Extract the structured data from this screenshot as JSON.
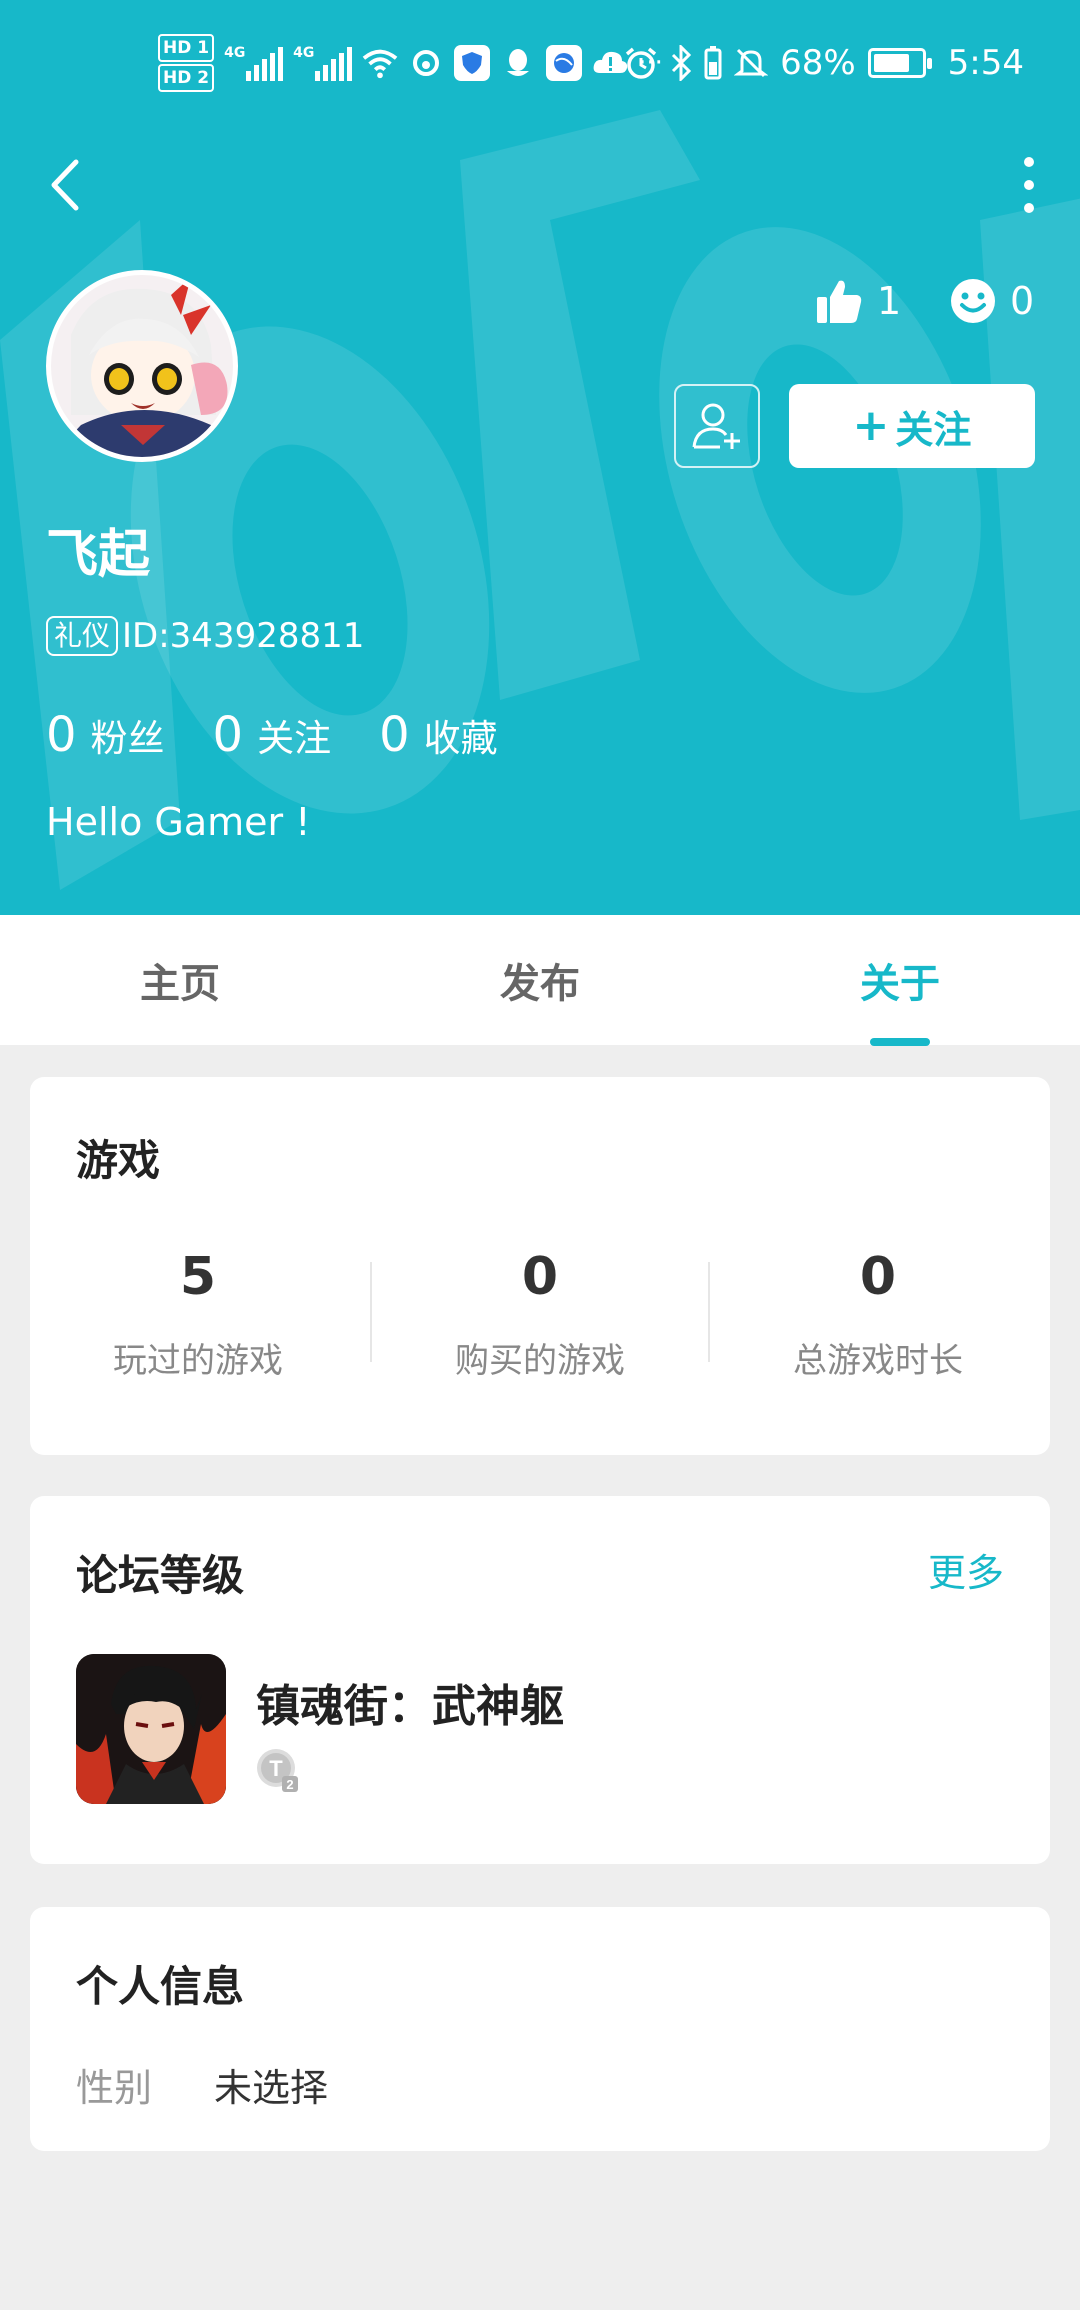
{
  "status_bar": {
    "hd1": "HD 1",
    "hd2": "HD 2",
    "net1": "4G",
    "net2": "4G",
    "battery": "68%",
    "time": "5:54",
    "more": "···"
  },
  "profile": {
    "username": "飞起",
    "badge": "礼仪",
    "id_text": "ID:343928811",
    "likes": "1",
    "smiles": "0",
    "follow_label": "关注",
    "counts": [
      {
        "num": "0",
        "label": "粉丝"
      },
      {
        "num": "0",
        "label": "关注"
      },
      {
        "num": "0",
        "label": "收藏"
      }
    ],
    "bio": "Hello Gamer !"
  },
  "tabs": [
    {
      "label": "主页"
    },
    {
      "label": "发布"
    },
    {
      "label": "关于"
    }
  ],
  "games": {
    "title": "游戏",
    "stats": [
      {
        "value": "5",
        "label": "玩过的游戏"
      },
      {
        "value": "0",
        "label": "购买的游戏"
      },
      {
        "value": "0",
        "label": "总游戏时长"
      }
    ]
  },
  "forum": {
    "title": "论坛等级",
    "more": "更多",
    "game_name": "镇魂街：武神躯",
    "level_letter": "T",
    "level_number": "2"
  },
  "personal": {
    "title": "个人信息",
    "gender_key": "性别",
    "gender_value": "未选择"
  },
  "colors": {
    "accent": "#17b8c9",
    "background": "#eeeeee"
  }
}
